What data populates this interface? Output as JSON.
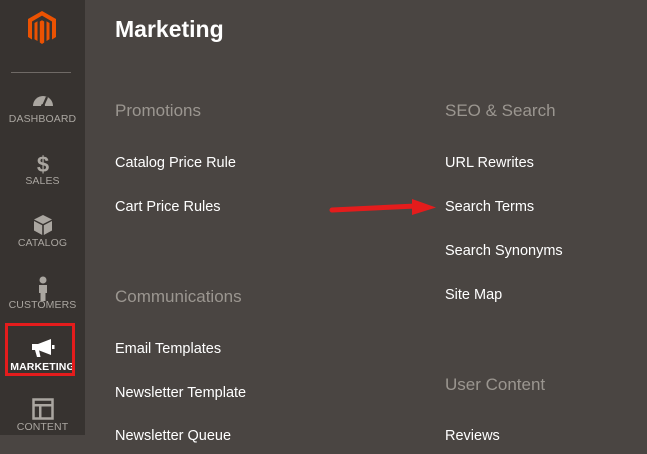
{
  "sidebar": {
    "items": [
      {
        "label": "DASHBOARD",
        "icon": "dashboard-icon"
      },
      {
        "label": "SALES",
        "icon": "dollar-icon"
      },
      {
        "label": "CATALOG",
        "icon": "cube-icon"
      },
      {
        "label": "CUSTOMERS",
        "icon": "person-icon"
      },
      {
        "label": "MARKETING",
        "icon": "megaphone-icon"
      },
      {
        "label": "CONTENT",
        "icon": "layout-icon"
      }
    ],
    "active": "MARKETING"
  },
  "panel": {
    "title": "Marketing",
    "sections": {
      "promotions": {
        "title": "Promotions",
        "links": [
          "Catalog Price Rule",
          "Cart Price Rules"
        ]
      },
      "communications": {
        "title": "Communications",
        "links": [
          "Email Templates",
          "Newsletter Template",
          "Newsletter Queue"
        ]
      },
      "seo": {
        "title": "SEO & Search",
        "links": [
          "URL Rewrites",
          "Search Terms",
          "Search Synonyms",
          "Site Map"
        ]
      },
      "user_content": {
        "title": "User Content",
        "links": [
          "Reviews"
        ]
      }
    }
  },
  "colors": {
    "sidebar_bg": "#373330",
    "panel_bg": "#4a4542",
    "accent": "#eb5202",
    "highlight": "#e41c1c"
  }
}
